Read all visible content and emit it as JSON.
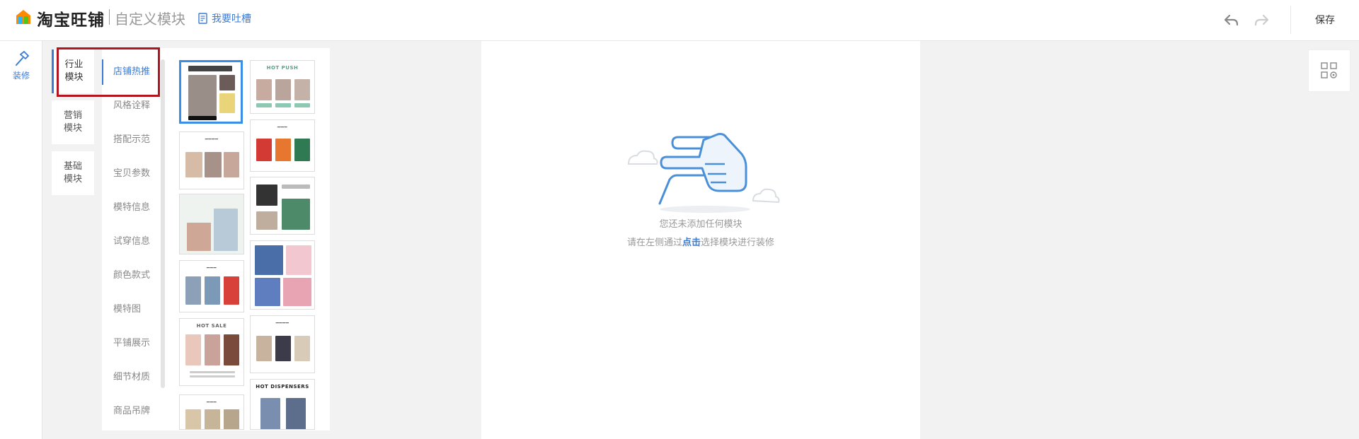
{
  "header": {
    "brand": "淘宝旺铺",
    "subtitle": "自定义模块",
    "feedback_label": "我要吐槽",
    "undo_icon": "undo-icon",
    "redo_icon": "redo-icon",
    "save_label": "保存"
  },
  "rail": {
    "decorate_label": "装修",
    "decorate_icon": "hammer-icon"
  },
  "categories": [
    {
      "label": "行业\n模块",
      "active": true
    },
    {
      "label": "营销\n模块",
      "active": false
    },
    {
      "label": "基础\n模块",
      "active": false
    }
  ],
  "subcategories": [
    {
      "label": "店铺热推",
      "active": true
    },
    {
      "label": "风格诠释"
    },
    {
      "label": "搭配示范"
    },
    {
      "label": "宝贝参数"
    },
    {
      "label": "模特信息"
    },
    {
      "label": "试穿信息"
    },
    {
      "label": "颜色款式"
    },
    {
      "label": "模特图"
    },
    {
      "label": "平铺展示"
    },
    {
      "label": "细节材质"
    },
    {
      "label": "商品吊牌"
    }
  ],
  "thumbnails": {
    "hot_push": "HOT PUSH",
    "hot_sale": "HOT SALE",
    "hot_dispensers": "HOT DISPENSERS"
  },
  "canvas": {
    "empty_line1": "您还未添加任何模块",
    "empty_line2_prefix": "请在左侧通过",
    "empty_line2_highlight": "点击",
    "empty_line2_suffix": "选择模块进行装修"
  },
  "colors": {
    "accent": "#3a7bd5",
    "selected_border": "#3a8ee6",
    "annotation": "#b3141e"
  }
}
